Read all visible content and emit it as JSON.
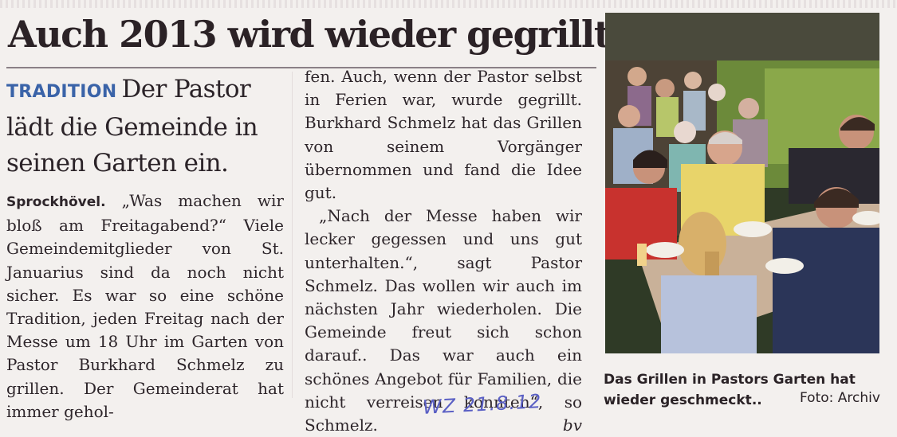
{
  "article": {
    "headline": "Auch 2013 wird wieder gegrillt",
    "kicker": "TRADITION",
    "deck": "Der Pastor lädt die Gemeinde in seinen Garten ein.",
    "location": "Sprockhövel.",
    "paragraph1": "„Was machen wir bloß am Freitagabend?“ Viele Gemeindemitglieder von St. Januarius sind da noch nicht sicher. Es war so eine schöne Tradition, jeden Freitag nach der Messe um 18 Uhr im Garten von Pastor Burkhard Schmelz zu grillen. Der Gemeinderat hat immer gehol-",
    "paragraph2": "fen. Auch, wenn der Pastor selbst in Ferien war, wurde gegrillt. Burkhard Schmelz hat das Grillen von seinem Vorgänger übernommen und fand die Idee gut.",
    "paragraph3": "„Nach der Messe haben wir lecker gegessen und uns gut unterhalten.“, sagt Pastor Schmelz. Das wollen wir auch im nächsten Jahr wiederholen. Die Gemeinde freut sich schon darauf.. Das war auch ein schönes Angebot für Familien, die nicht verreisen konnten“, so Schmelz.",
    "author": "bv",
    "handwritten_note": "WZ 21.8.12"
  },
  "photo": {
    "caption": "Das Grillen in Pastors Garten hat wieder geschmeckt..",
    "credit": "Foto: Archiv"
  }
}
